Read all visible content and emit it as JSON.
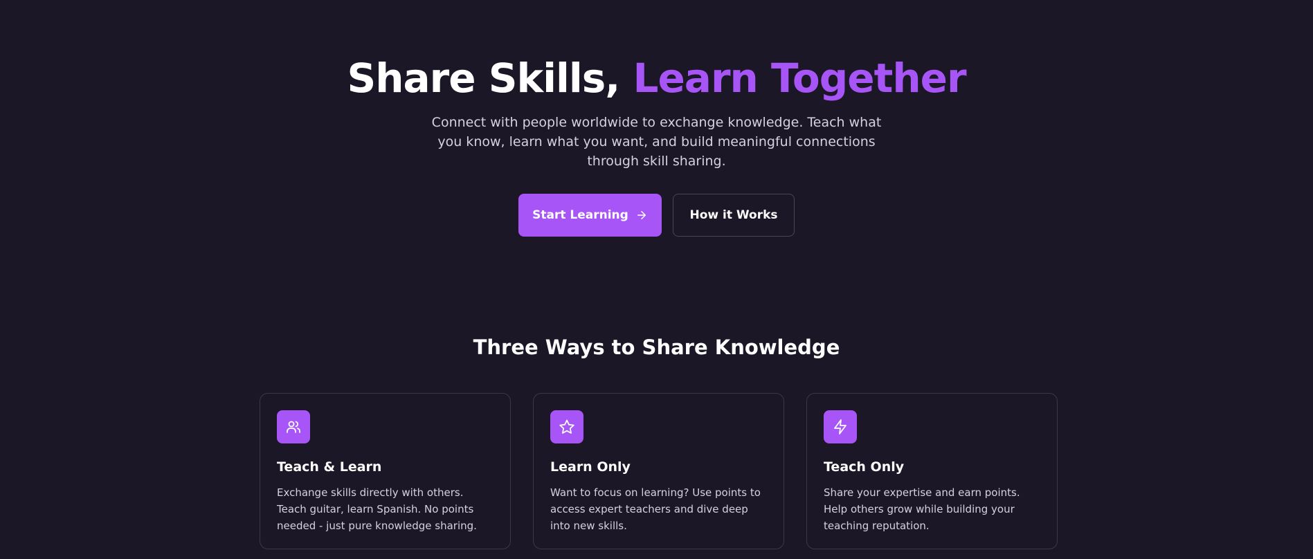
{
  "hero": {
    "title_plain": "Share Skills, ",
    "title_accent": "Learn Together",
    "subtitle": "Connect with people worldwide to exchange knowledge. Teach what you know, learn what you want, and build meaningful connections through skill sharing.",
    "primary_button": "Start Learning",
    "primary_button_icon": "arrow-right-icon",
    "secondary_button": "How it Works"
  },
  "features": {
    "title": "Three Ways to Share Knowledge",
    "cards": [
      {
        "icon": "users-icon",
        "title": "Teach & Learn",
        "text": "Exchange skills directly with others. Teach guitar, learn Spanish. No points needed - just pure knowledge sharing."
      },
      {
        "icon": "star-icon",
        "title": "Learn Only",
        "text": "Want to focus on learning? Use points to access expert teachers and dive deep into new skills."
      },
      {
        "icon": "lightning-icon",
        "title": "Teach Only",
        "text": "Share your expertise and earn points. Help others grow while building your teaching reputation."
      }
    ]
  },
  "colors": {
    "background": "#1b1726",
    "accent": "#a855f7",
    "text_primary": "#ffffff",
    "text_secondary": "#d6d1e0",
    "border": "#3d3848"
  }
}
